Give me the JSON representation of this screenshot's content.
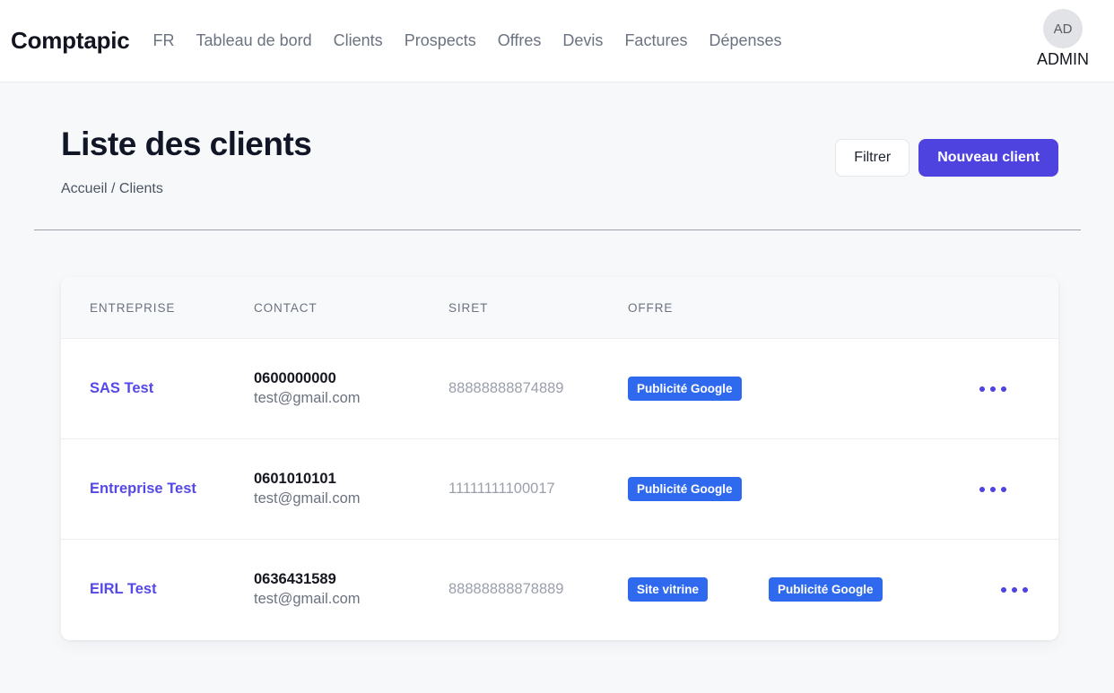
{
  "navbar": {
    "brand": "Comptapic",
    "links": [
      {
        "label": "FR",
        "name": "nav-link-fr"
      },
      {
        "label": "Tableau de bord",
        "name": "nav-link-dashboard"
      },
      {
        "label": "Clients",
        "name": "nav-link-clients"
      },
      {
        "label": "Prospects",
        "name": "nav-link-prospects"
      },
      {
        "label": "Offres",
        "name": "nav-link-offres"
      },
      {
        "label": "Devis",
        "name": "nav-link-devis"
      },
      {
        "label": "Factures",
        "name": "nav-link-factures"
      },
      {
        "label": "Dépenses",
        "name": "nav-link-depenses"
      }
    ],
    "user": {
      "initials": "AD",
      "name": "ADMIN"
    }
  },
  "header": {
    "title": "Liste des clients",
    "breadcrumb": "Accueil / Clients",
    "filter_button": "Filtrer",
    "new_client_button": "Nouveau client"
  },
  "table": {
    "columns": [
      "ENTREPRISE",
      "CONTACT",
      "SIRET",
      "OFFRE"
    ],
    "rows": [
      {
        "company": "SAS Test",
        "phone": "0600000000",
        "email": "test@gmail.com",
        "siret": "88888888874889",
        "offers": [
          "Publicité Google"
        ],
        "actions_icon": "ellipsis-horizontal-icon"
      },
      {
        "company": "Entreprise Test",
        "phone": "0601010101",
        "email": "test@gmail.com",
        "siret": "11111111100017",
        "offers": [
          "Publicité Google"
        ],
        "actions_icon": "ellipsis-horizontal-icon"
      },
      {
        "company": "EIRL Test",
        "phone": "0636431589",
        "email": "test@gmail.com",
        "siret": "88888888878889",
        "offers": [
          "Site vitrine",
          "Publicité Google"
        ],
        "actions_icon": "ellipsis-horizontal-icon"
      }
    ]
  },
  "colors": {
    "primary": "#4f43e0",
    "link": "#5548e8",
    "badge": "#2f6aee",
    "page_bg": "#f7f8fa",
    "muted": "#6b7280"
  }
}
